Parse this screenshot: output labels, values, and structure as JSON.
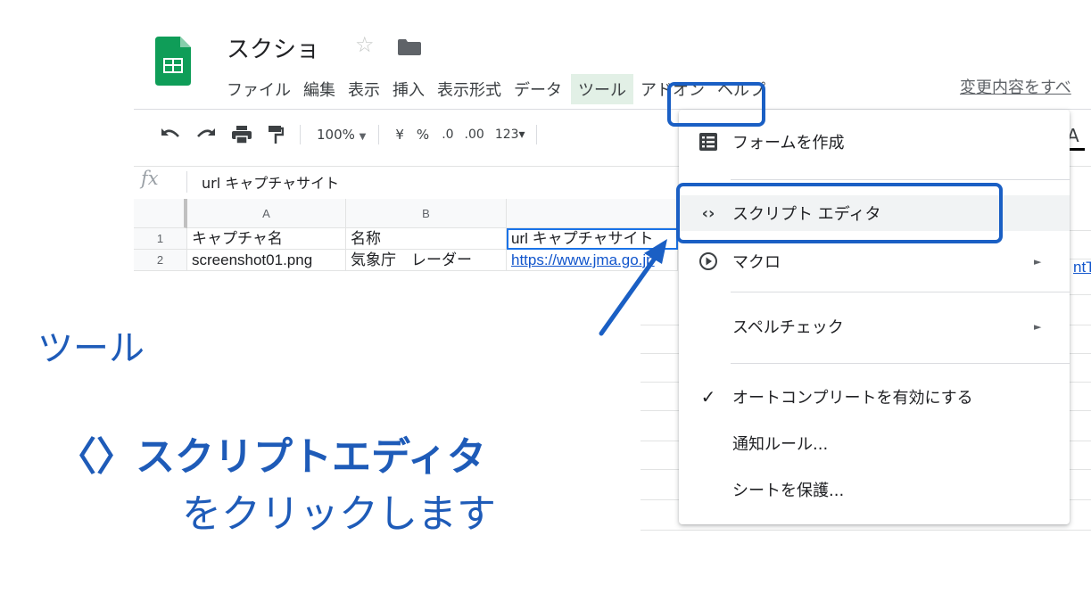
{
  "document": {
    "title": "スクショ"
  },
  "menu": {
    "items": [
      "ファイル",
      "編集",
      "表示",
      "挿入",
      "表示形式",
      "データ"
    ],
    "active": "ツール",
    "after": [
      "アドオン",
      "ヘルプ"
    ],
    "changes_link": "変更内容をすべ"
  },
  "toolbar": {
    "zoom": "100%",
    "currency": "¥",
    "percent": "%",
    "dec_less": ".0",
    "dec_more": ".00",
    "format": "123▾"
  },
  "formula_bar": {
    "fx": "fx",
    "content": "url キャプチャサイト"
  },
  "sheet": {
    "columns": [
      "A",
      "B"
    ],
    "rows": [
      {
        "num": "1",
        "cells": [
          "キャプチャ名",
          "名称",
          "url キャプチャサイト"
        ]
      },
      {
        "num": "2",
        "cells": [
          "screenshot01.png",
          "気象庁　レーダー",
          "https://www.jma.go.jp"
        ]
      }
    ],
    "right_edge_text": "ntT"
  },
  "dropdown": {
    "form": "フォームを作成",
    "script": "スクリプト エディタ",
    "macro": "マクロ",
    "spell": "スペルチェック",
    "autocomplete": "オートコンプリートを有効にする",
    "notify": "通知ルール...",
    "protect": "シートを保護..."
  },
  "annotation": {
    "tool_label": "ツール",
    "editor_label": "〈〉スクリプトエディタ",
    "click_label": "をクリックします"
  },
  "colors": {
    "accent": "#1e5bb8",
    "sheets_green": "#0f9d58",
    "link": "#1155cc"
  }
}
